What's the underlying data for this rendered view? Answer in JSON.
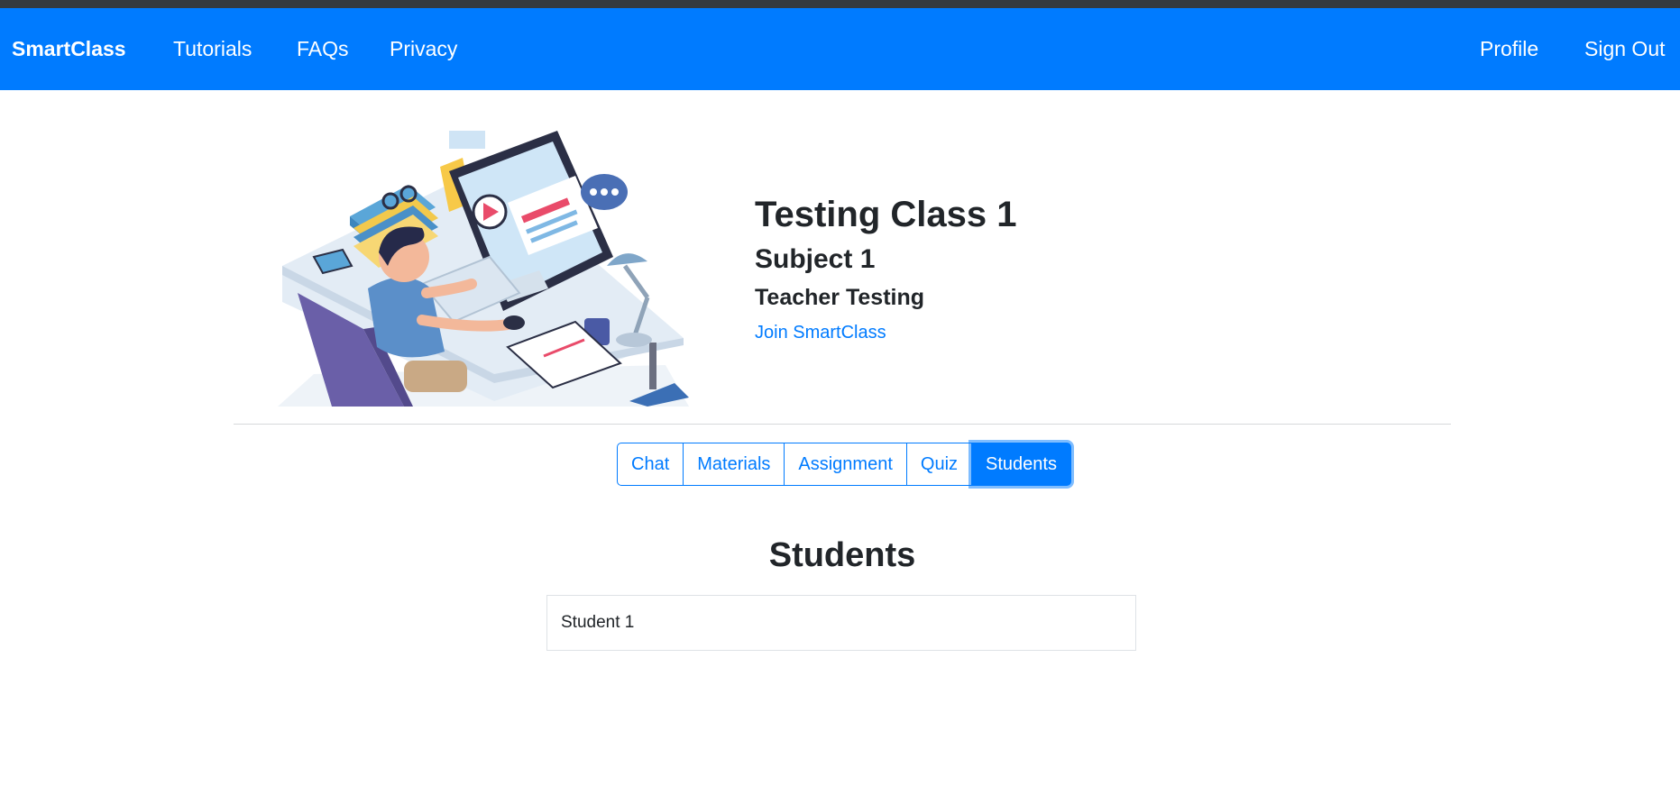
{
  "navbar": {
    "brand": "SmartClass",
    "links": [
      "Tutorials",
      "FAQs",
      "Privacy"
    ],
    "right_links": [
      "Profile",
      "Sign Out"
    ]
  },
  "class_info": {
    "title": "Testing Class 1",
    "subject": "Subject 1",
    "teacher": "Teacher Testing",
    "join_link": "Join SmartClass"
  },
  "tabs": [
    "Chat",
    "Materials",
    "Assignment",
    "Quiz",
    "Students"
  ],
  "active_tab": "Students",
  "students_section": {
    "title": "Students",
    "items": [
      "Student 1"
    ]
  },
  "colors": {
    "primary": "#007bff",
    "top_strip": "#343a40"
  }
}
